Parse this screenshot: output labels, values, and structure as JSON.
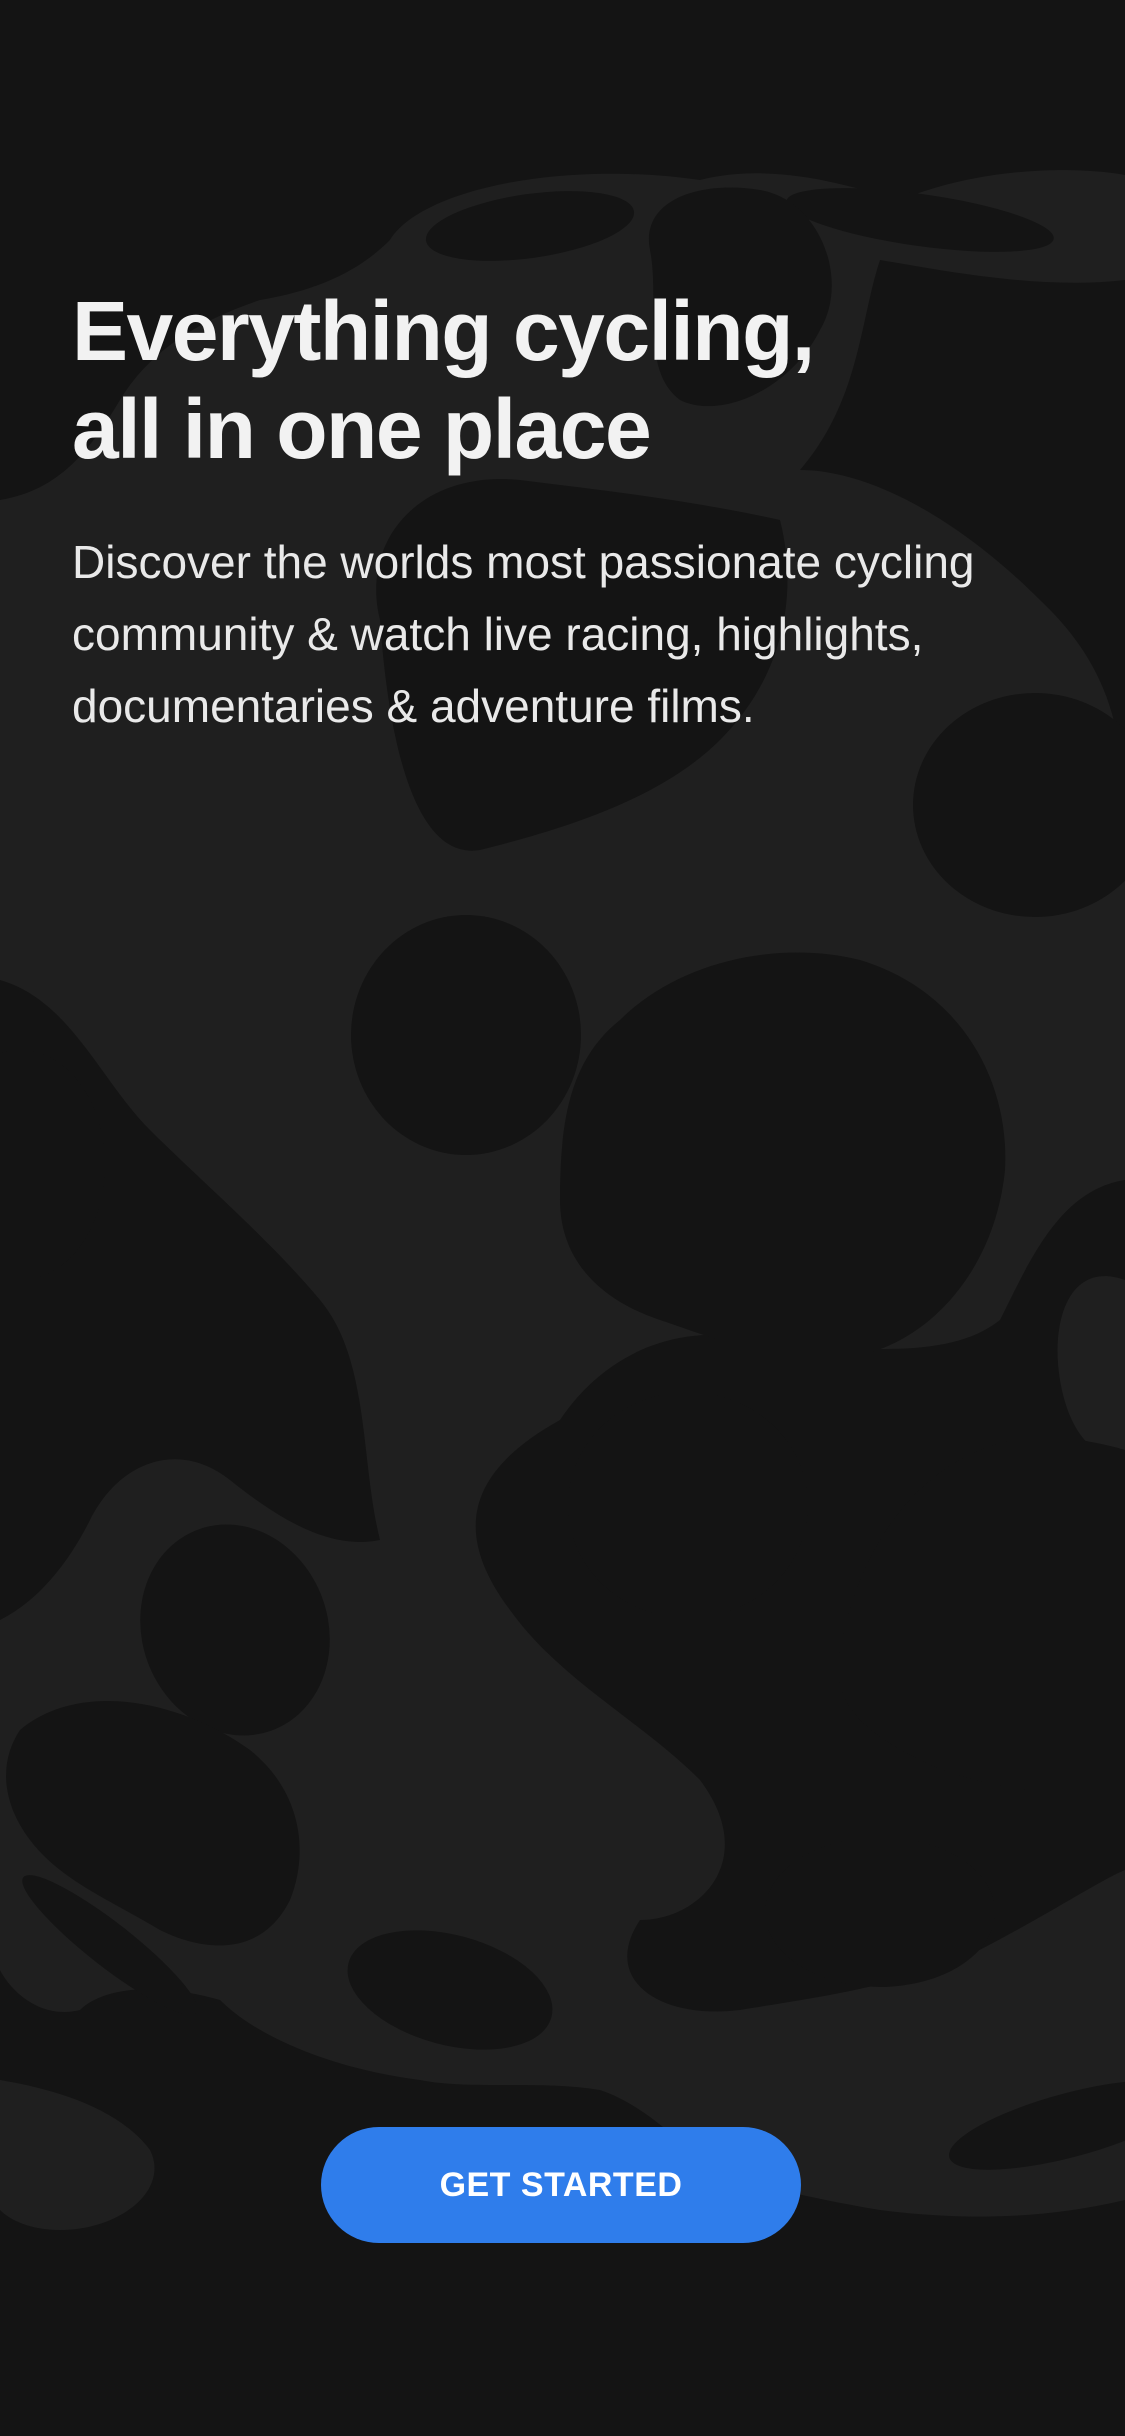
{
  "onboarding": {
    "headline_line1": "Everything cycling,",
    "headline_line2": "all in one place",
    "subtitle_line1": "Discover the worlds most passionate cycling",
    "subtitle_line2": "community & watch live racing, highlights,",
    "subtitle_line3": "documentaries & adventure films.",
    "cta_label": "GET STARTED"
  },
  "theme": {
    "background": "#141414",
    "pattern": "#1f1f1f",
    "accent": "#2f7deb",
    "text": "#f2f2f2"
  }
}
